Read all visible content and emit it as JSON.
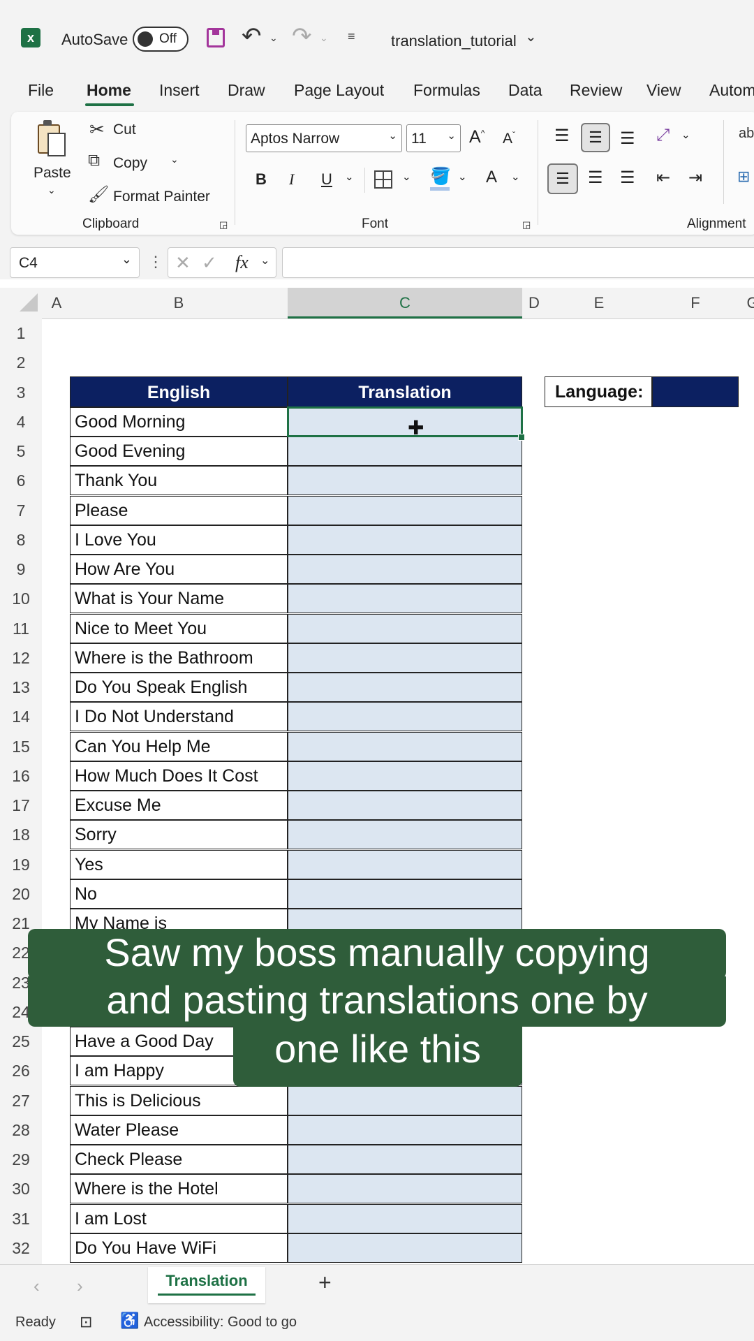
{
  "titlebar": {
    "autosave_label": "AutoSave",
    "autosave_state": "Off",
    "filename": "translation_tutorial"
  },
  "menu": [
    "File",
    "Home",
    "Insert",
    "Draw",
    "Page Layout",
    "Formulas",
    "Data",
    "Review",
    "View",
    "Autom"
  ],
  "ribbon": {
    "clipboard": {
      "paste": "Paste",
      "cut": "Cut",
      "copy": "Copy",
      "format_painter": "Format Painter",
      "group_label": "Clipboard"
    },
    "font": {
      "font_name": "Aptos Narrow",
      "font_size": "11",
      "group_label": "Font",
      "bold": "B",
      "italic": "I",
      "underline": "U"
    },
    "alignment": {
      "group_label": "Alignment"
    }
  },
  "formula_bar": {
    "name_box": "C4",
    "fx": "fx",
    "value": ""
  },
  "columns": [
    "A",
    "B",
    "C",
    "D",
    "E",
    "F",
    "G"
  ],
  "sheet": {
    "header_english": "English",
    "header_translation": "Translation",
    "language_label": "Language:",
    "language_value": "",
    "rows": [
      {
        "n": "1",
        "en": ""
      },
      {
        "n": "2",
        "en": ""
      },
      {
        "n": "3",
        "en": ""
      },
      {
        "n": "4",
        "en": "Good Morning"
      },
      {
        "n": "5",
        "en": "Good Evening"
      },
      {
        "n": "6",
        "en": "Thank You"
      },
      {
        "n": "7",
        "en": "Please"
      },
      {
        "n": "8",
        "en": "I Love You"
      },
      {
        "n": "9",
        "en": "How Are You"
      },
      {
        "n": "10",
        "en": "What is Your Name"
      },
      {
        "n": "11",
        "en": "Nice to Meet You"
      },
      {
        "n": "12",
        "en": "Where is the Bathroom"
      },
      {
        "n": "13",
        "en": "Do You Speak English"
      },
      {
        "n": "14",
        "en": "I Do Not Understand"
      },
      {
        "n": "15",
        "en": "Can You Help Me"
      },
      {
        "n": "16",
        "en": "How Much Does It Cost"
      },
      {
        "n": "17",
        "en": "Excuse Me"
      },
      {
        "n": "18",
        "en": "Sorry"
      },
      {
        "n": "19",
        "en": "Yes"
      },
      {
        "n": "20",
        "en": "No"
      },
      {
        "n": "21",
        "en": "My Name is"
      },
      {
        "n": "22",
        "en": ""
      },
      {
        "n": "23",
        "en": ""
      },
      {
        "n": "24",
        "en": ""
      },
      {
        "n": "25",
        "en": "Have a Good Day"
      },
      {
        "n": "26",
        "en": "I am Happy"
      },
      {
        "n": "27",
        "en": "This is Delicious"
      },
      {
        "n": "28",
        "en": "Water Please"
      },
      {
        "n": "29",
        "en": "Check Please"
      },
      {
        "n": "30",
        "en": "Where is the Hotel"
      },
      {
        "n": "31",
        "en": "I am Lost"
      },
      {
        "n": "32",
        "en": "Do You Have WiFi"
      }
    ]
  },
  "caption": {
    "line1": "Saw my boss manually copying",
    "line2": "and pasting translations one by",
    "line3": "one like this"
  },
  "tabs": {
    "active": "Translation",
    "add": "+"
  },
  "status": {
    "ready": "Ready",
    "accessibility": "Accessibility: Good to go"
  },
  "colors": {
    "header_navy": "#0c2061",
    "translation_fill": "#dce6f1",
    "caption_green": "#2f5d3a",
    "excel_green": "#1e7145"
  }
}
